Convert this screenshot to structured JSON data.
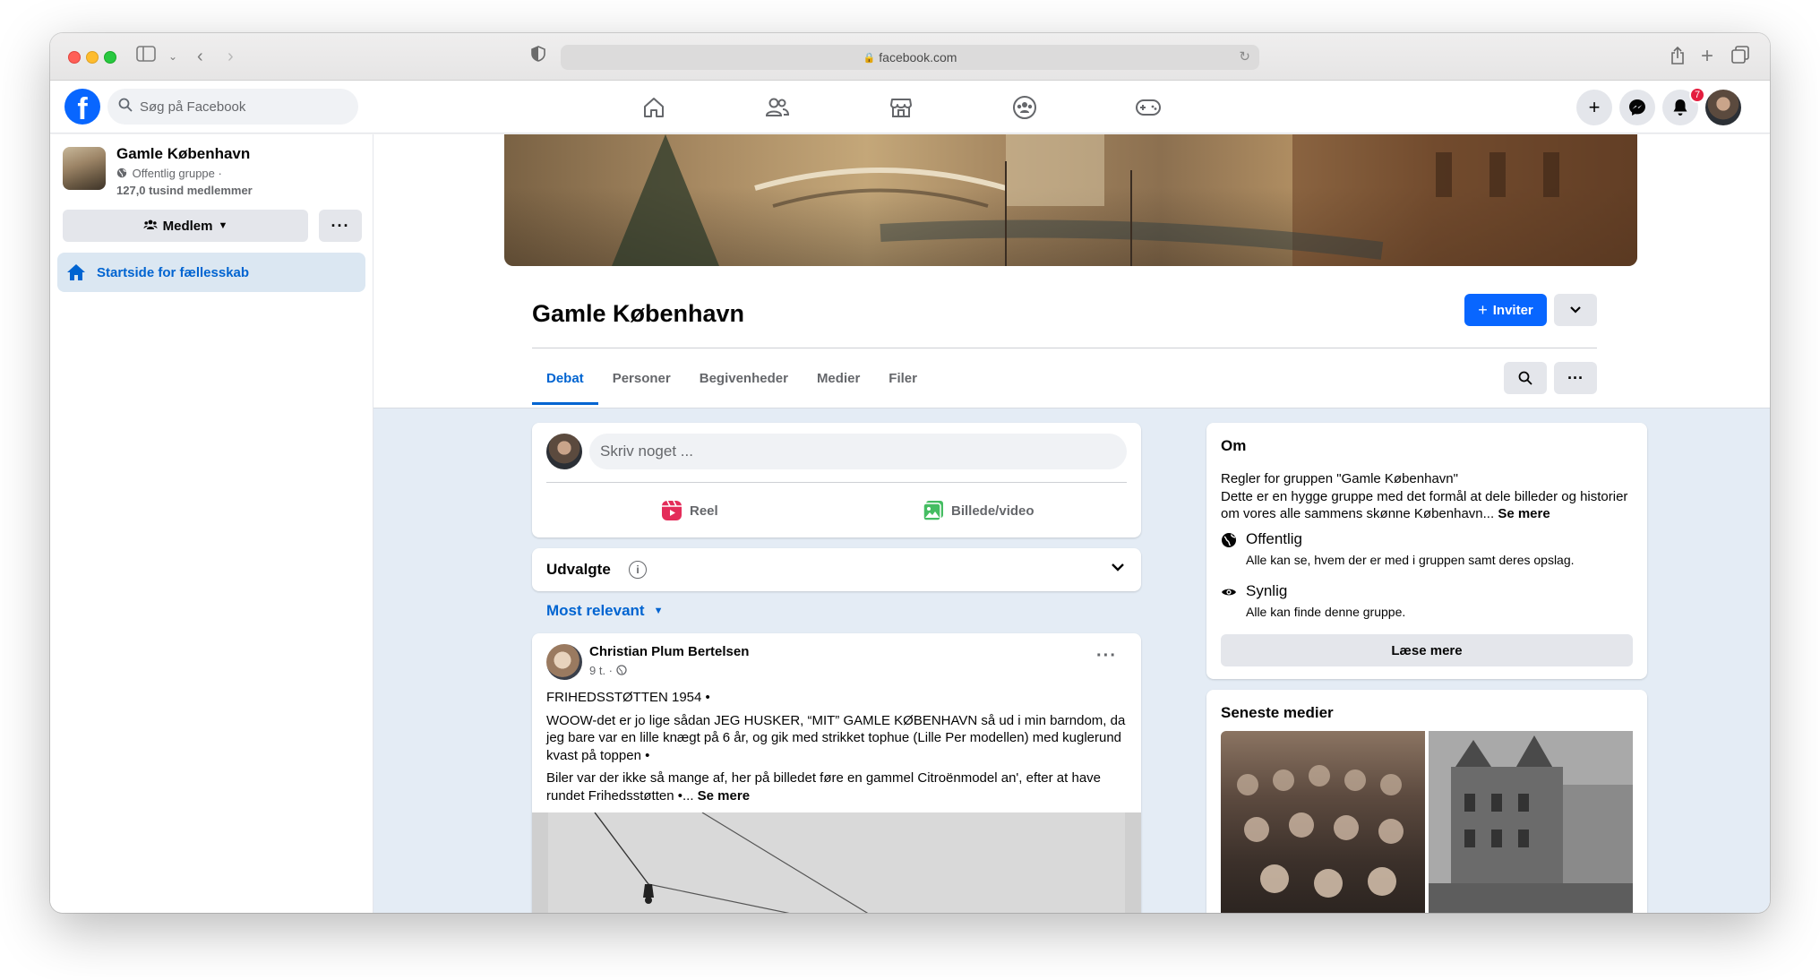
{
  "browser": {
    "url": "facebook.com"
  },
  "fb": {
    "logo": "f",
    "search_placeholder": "Søg på Facebook",
    "notification_count": "7"
  },
  "sidebar": {
    "group_name": "Gamle København",
    "group_type": "Offentlig gruppe ·",
    "members": "127,0 tusind medlemmer",
    "member_button": "Medlem",
    "home_item": "Startside for fællesskab"
  },
  "header": {
    "title": "Gamle København",
    "invite_label": "Inviter"
  },
  "tabs": [
    {
      "label": "Debat",
      "active": true
    },
    {
      "label": "Personer",
      "active": false
    },
    {
      "label": "Begivenheder",
      "active": false
    },
    {
      "label": "Medier",
      "active": false
    },
    {
      "label": "Filer",
      "active": false
    }
  ],
  "composer": {
    "placeholder": "Skriv noget ...",
    "reel_label": "Reel",
    "photo_label": "Billede/video"
  },
  "featured": {
    "label": "Udvalgte"
  },
  "sort": {
    "label": "Most relevant"
  },
  "post": {
    "author": "Christian Plum Bertelsen",
    "time": "9 t. ·",
    "paragraphs": [
      "FRIHEDSSTØTTEN 1954 •",
      "WOOW-det er jo lige sådan JEG HUSKER, “MIT” GAMLE KØBENHAVN så ud i min barndom, da jeg bare var en lille knægt på 6 år, og gik med strikket tophue (Lille Per modellen) med kuglerund kvast på toppen •",
      "Biler var der ikke så mange af, her på billedet føre en gammel Citroënmodel an', efter at have rundet Frihedsstøtten •..."
    ],
    "see_more": "Se mere"
  },
  "about": {
    "heading": "Om",
    "desc": "Regler for gruppen \"Gamle København\"\nDette er en hygge gruppe med det formål at dele billeder og historier om vores alle sammens skønne København...",
    "see_more": "Se mere",
    "public_title": "Offentlig",
    "public_desc": "Alle kan se, hvem der er med i gruppen samt deres opslag.",
    "visible_title": "Synlig",
    "visible_desc": "Alle kan finde denne gruppe.",
    "read_more": "Læse mere"
  },
  "media": {
    "heading": "Seneste medier"
  },
  "colors": {
    "brand": "#0866ff",
    "link": "#0064d1",
    "badge": "#e41e3f"
  }
}
